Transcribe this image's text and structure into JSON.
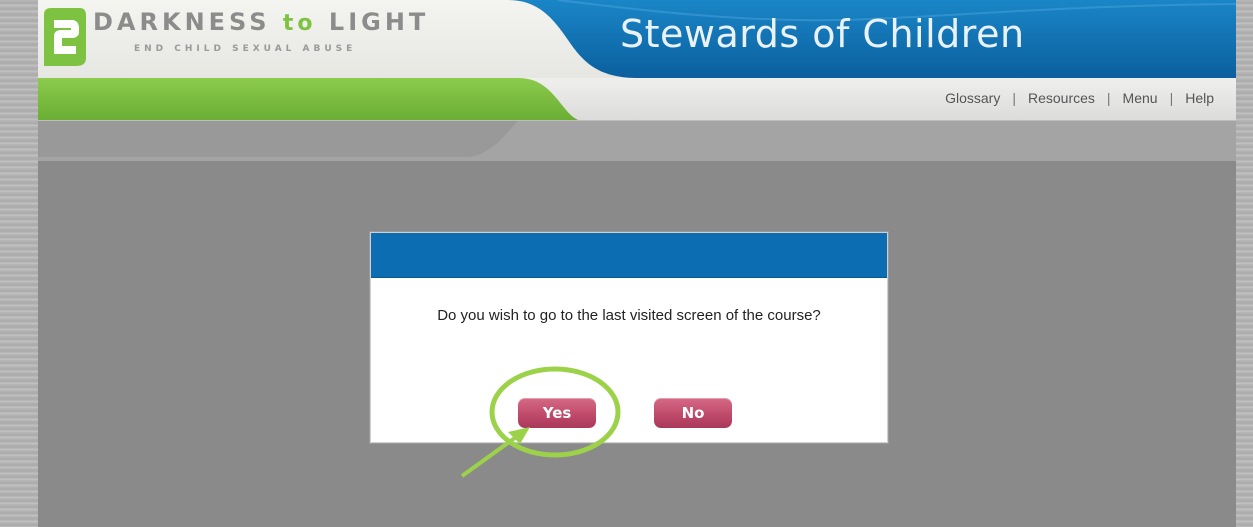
{
  "brand": {
    "name_left": "DARKNESS",
    "name_middle": "to",
    "name_right": "LIGHT",
    "tagline": "END CHILD SEXUAL ABUSE"
  },
  "course": {
    "title": "Stewards of Children"
  },
  "nav": {
    "items": [
      "Glossary",
      "Resources",
      "Menu",
      "Help"
    ]
  },
  "dialog": {
    "message": "Do you wish to go to the last visited screen of the course?",
    "yes_label": "Yes",
    "no_label": "No"
  },
  "colors": {
    "header_blue": "#0c6db2",
    "brand_green": "#7ec242",
    "button_pink": "#bf4a6a",
    "annotation_green": "#9cd24a",
    "overlay_gray": "#8a8a8a"
  }
}
